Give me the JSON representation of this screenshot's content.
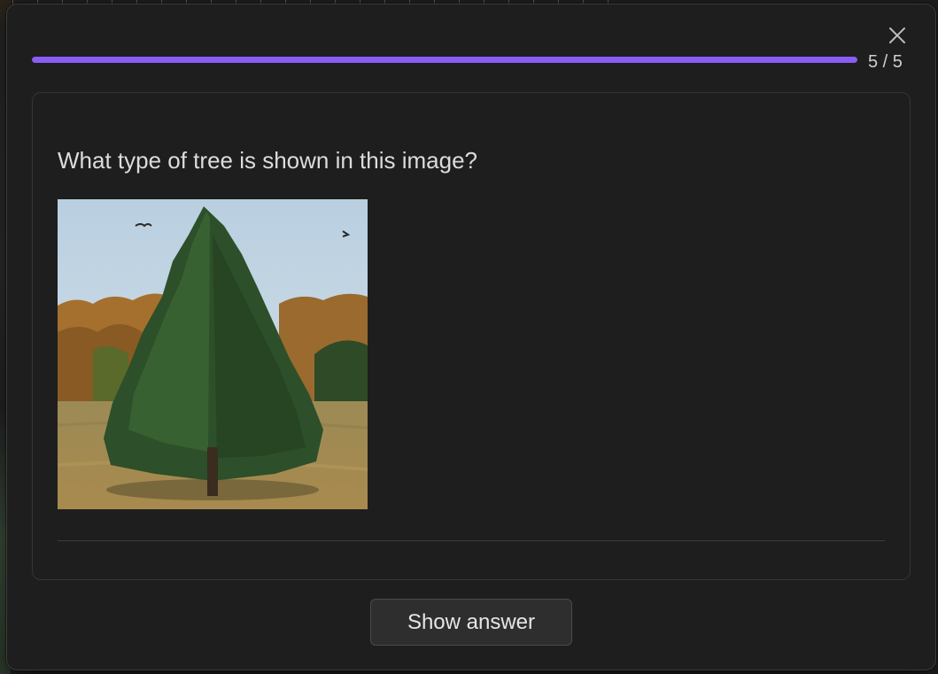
{
  "progress": {
    "current": 5,
    "total": 5,
    "label": "5 / 5",
    "fraction": 1.0,
    "fill_color": "#8a5cf6"
  },
  "close": {
    "icon": "close-icon"
  },
  "card": {
    "question": "What type of tree is shown in this image?",
    "image": {
      "icon": "tree-photo"
    }
  },
  "actions": {
    "show_answer_label": "Show answer"
  }
}
